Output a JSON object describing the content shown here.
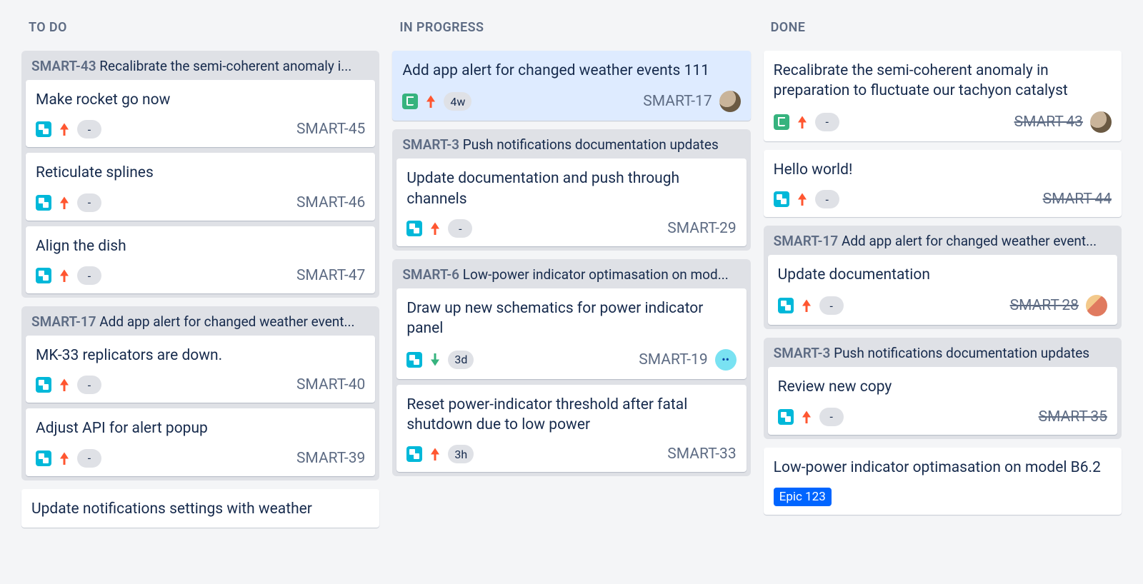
{
  "columns": [
    {
      "title": "TO DO",
      "groups": [
        {
          "key": "SMART-43",
          "title": "Recalibrate the semi-coherent anomaly i...",
          "cards": [
            {
              "title": "Make rocket go now",
              "type": "subtask",
              "priority": "up",
              "estimate": "-",
              "key": "SMART-45"
            },
            {
              "title": "Reticulate splines",
              "type": "subtask",
              "priority": "up",
              "estimate": "-",
              "key": "SMART-46"
            },
            {
              "title": "Align the dish",
              "type": "subtask",
              "priority": "up",
              "estimate": "-",
              "key": "SMART-47"
            }
          ]
        },
        {
          "key": "SMART-17",
          "title": "Add app alert for changed weather event...",
          "cards": [
            {
              "title": "MK-33 replicators are down.",
              "type": "subtask",
              "priority": "up",
              "estimate": "-",
              "key": "SMART-40"
            },
            {
              "title": "Adjust API for alert popup",
              "type": "subtask",
              "priority": "up",
              "estimate": "-",
              "key": "SMART-39"
            }
          ]
        },
        {
          "cards": [
            {
              "title": "Update notifications settings with weather",
              "key": ""
            }
          ]
        }
      ]
    },
    {
      "title": "IN PROGRESS",
      "groups": [
        {
          "cards": [
            {
              "title": "Add app alert for changed weather events 111",
              "type": "story",
              "priority": "up",
              "estimate": "4w",
              "key": "SMART-17",
              "avatar": "person1",
              "selected": true
            }
          ]
        },
        {
          "key": "SMART-3",
          "title": "Push notifications documentation updates",
          "cards": [
            {
              "title": "Update documentation and push through channels",
              "type": "subtask",
              "priority": "up",
              "estimate": "-",
              "key": "SMART-29"
            }
          ]
        },
        {
          "key": "SMART-6",
          "title": "Low-power indicator optimasation on mod...",
          "cards": [
            {
              "title": "Draw up new schematics for power indicator panel",
              "type": "subtask",
              "priority": "down",
              "estimate": "3d",
              "key": "SMART-19",
              "avatar": "bot"
            },
            {
              "title": "Reset power-indicator threshold after fatal shutdown due to low power",
              "type": "subtask",
              "priority": "up",
              "estimate": "3h",
              "key": "SMART-33"
            }
          ]
        }
      ]
    },
    {
      "title": "DONE",
      "groups": [
        {
          "cards": [
            {
              "title": "Recalibrate the semi-coherent anomaly in preparation to fluctuate our tachyon catalyst",
              "type": "story",
              "priority": "up",
              "estimate": "-",
              "key": "SMART-43",
              "done": true,
              "avatar": "person1"
            },
            {
              "title": "Hello world!",
              "type": "subtask",
              "priority": "up",
              "estimate": "-",
              "key": "SMART-44",
              "done": true
            }
          ]
        },
        {
          "key": "SMART-17",
          "title": "Add app alert for changed weather event...",
          "cards": [
            {
              "title": "Update documentation",
              "type": "subtask",
              "priority": "up",
              "estimate": "-",
              "key": "SMART-28",
              "done": true,
              "avatar": "person2"
            }
          ]
        },
        {
          "key": "SMART-3",
          "title": "Push notifications documentation updates",
          "cards": [
            {
              "title": "Review new copy",
              "type": "subtask",
              "priority": "up",
              "estimate": "-",
              "key": "SMART-35",
              "done": true
            }
          ]
        },
        {
          "cards": [
            {
              "title": "Low-power indicator optimasation on model B6.2",
              "epic": "Epic 123"
            }
          ]
        }
      ]
    }
  ]
}
